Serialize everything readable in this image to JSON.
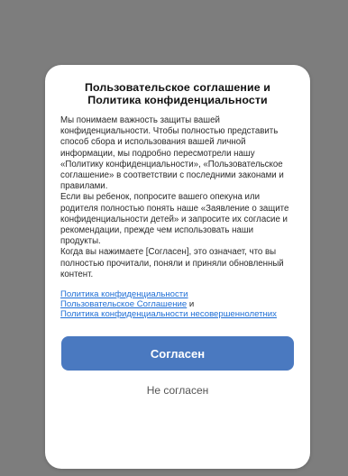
{
  "dialog": {
    "title": "Пользовательское соглашение и Политика конфиденциальности",
    "paragraphs": [
      "Мы понимаем важность защиты вашей конфиденциальности. Чтобы полностью представить способ сбора и использования вашей личной информации, мы подробно пересмотрели нашу «Политику конфиденциальности», «Пользовательское соглашение» в соответствии с последними законами и правилами.",
      "Если вы ребенок, попросите вашего опекуна или родителя полностью понять наше «Заявление о защите конфиденциальности детей» и запросите их согласие и рекомендации, прежде чем использовать наши продукты.",
      "Когда вы нажимаете [Согласен], это означает, что вы полностью прочитали, поняли и приняли обновленный контент."
    ],
    "links": {
      "privacy_policy": "Политика конфиденциальности",
      "user_agreement": "Пользовательское Соглашение",
      "and": "и",
      "minors_privacy_policy": "Политика конфиденциальности несовершеннолетних"
    },
    "buttons": {
      "agree": "Согласен",
      "disagree": "Не согласен"
    }
  },
  "colors": {
    "backdrop": "#7d7d7d",
    "dialog_background": "#ffffff",
    "primary_button": "#4a79c0",
    "link": "#1f6fd6"
  }
}
